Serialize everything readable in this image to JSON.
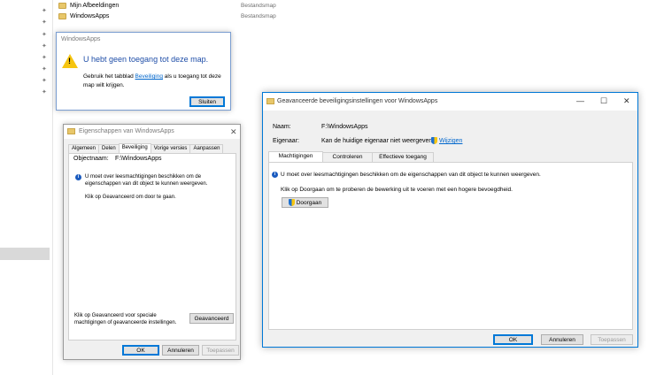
{
  "explorer": {
    "rows": [
      {
        "name": "Mijn Afbeeldingen",
        "type": "Bestandsmap"
      },
      {
        "name": "WindowsApps",
        "type": "Bestandsmap"
      }
    ],
    "pin_glyph": "📌"
  },
  "msgbox": {
    "title": "WindowsApps",
    "heading": "U hebt geen toegang tot deze map.",
    "body_pre": "Gebruik het tabblad ",
    "body_link": "Beveiliging",
    "body_post": " als u toegang tot deze map wilt krijgen.",
    "close_label": "Sluiten",
    "icon": "warning-icon"
  },
  "props": {
    "title": "Eigenschappen van WindowsApps",
    "tabs": [
      "Algemeen",
      "Delen",
      "Beveiliging",
      "Vorige versies",
      "Aanpassen"
    ],
    "object_label": "Objectnaam:",
    "object_value": "F:\\WindowsApps",
    "info_text": "U moet over leesmachtigingen beschikken om de eigenschappen van dit object te kunnen weergeven.",
    "hint_text": "Klik op Geavanceerd om door te gaan.",
    "bottom_text": "Klik op Geavanceerd voor speciale machtigingen of geavanceerde instellingen.",
    "advanced_label": "Geavanceerd",
    "ok_label": "OK",
    "cancel_label": "Annuleren",
    "apply_label": "Toepassen"
  },
  "adv": {
    "title": "Geavanceerde beveiligingsinstellingen voor WindowsApps",
    "name_label": "Naam:",
    "name_value": "F:\\WindowsApps",
    "owner_label": "Eigenaar:",
    "owner_value": "Kan de huidige eigenaar niet weergeven.",
    "change_label": "Wijzigen",
    "tabs": [
      "Machtigingen",
      "Controleren",
      "Effectieve toegang"
    ],
    "info_text": "U moet over leesmachtigingen beschikken om de eigenschappen van dit object te kunnen weergeven.",
    "continue_hint": "Klik op Doorgaan om te proberen de bewerking uit te voeren met een hogere bevoegdheid.",
    "continue_label": "Doorgaan",
    "ok_label": "OK",
    "cancel_label": "Annuleren",
    "apply_label": "Toepassen",
    "minimize_glyph": "—",
    "maximize_glyph": "☐",
    "close_glyph": "✕"
  },
  "colors": {
    "accent": "#0078d7",
    "link": "#0066cc",
    "heading": "#1f4ea8",
    "warning": "#f6c510"
  }
}
